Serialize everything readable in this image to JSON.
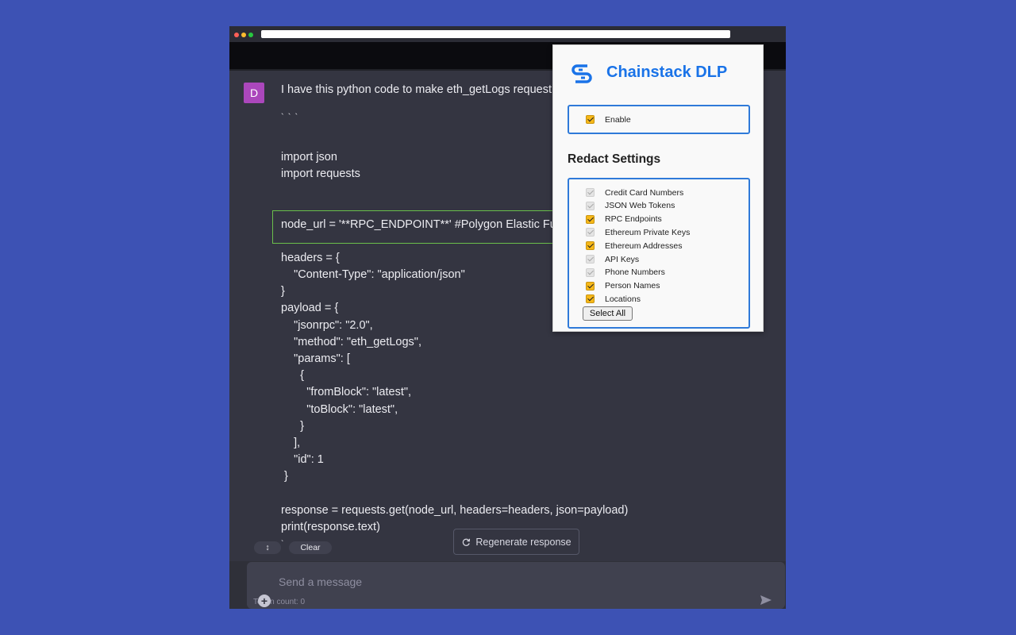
{
  "chat": {
    "avatar_initial": "D",
    "lines": [
      "I have this python code to make eth_getLogs request b",
      "` ` `",
      "import json",
      "import requests",
      "node_url = '**RPC_ENDPOINT**' #Polygon Elastic Full N",
      "headers = {",
      "    \"Content-Type\": \"application/json\"",
      "}",
      "payload = {",
      "    \"jsonrpc\": \"2.0\",",
      "    \"method\": \"eth_getLogs\",",
      "    \"params\": [",
      "      {",
      "        \"fromBlock\": \"latest\",",
      "        \"toBlock\": \"latest\",",
      "      }",
      "    ],",
      "    \"id\": 1",
      " }",
      "response = requests.get(node_url, headers=headers, json=payload)",
      "print(response.text)",
      "`"
    ],
    "toolbar": {
      "scroll_icon": "↕",
      "clear_label": "Clear"
    },
    "regenerate_label": "Regenerate response",
    "input_placeholder": "Send a message",
    "token_count": "Token count: 0"
  },
  "popup": {
    "title": "Chainstack DLP",
    "enable": {
      "label": "Enable",
      "checked": true
    },
    "redact_title": "Redact Settings",
    "items": [
      {
        "label": "Credit Card Numbers",
        "checked": false
      },
      {
        "label": "JSON Web Tokens",
        "checked": false
      },
      {
        "label": "RPC Endpoints",
        "checked": true
      },
      {
        "label": "Ethereum Private Keys",
        "checked": false
      },
      {
        "label": "Ethereum Addresses",
        "checked": true
      },
      {
        "label": "API Keys",
        "checked": false
      },
      {
        "label": "Phone Numbers",
        "checked": false
      },
      {
        "label": "Person Names",
        "checked": true
      },
      {
        "label": "Locations",
        "checked": true
      }
    ],
    "select_all_label": "Select All"
  },
  "colors": {
    "background": "#3d52b4",
    "chat_bg": "#343541",
    "brand_blue": "#1a73e8",
    "checkbox_checked": "#f6b819",
    "avatar": "#ab47bc",
    "highlight": "#6abf4b"
  }
}
